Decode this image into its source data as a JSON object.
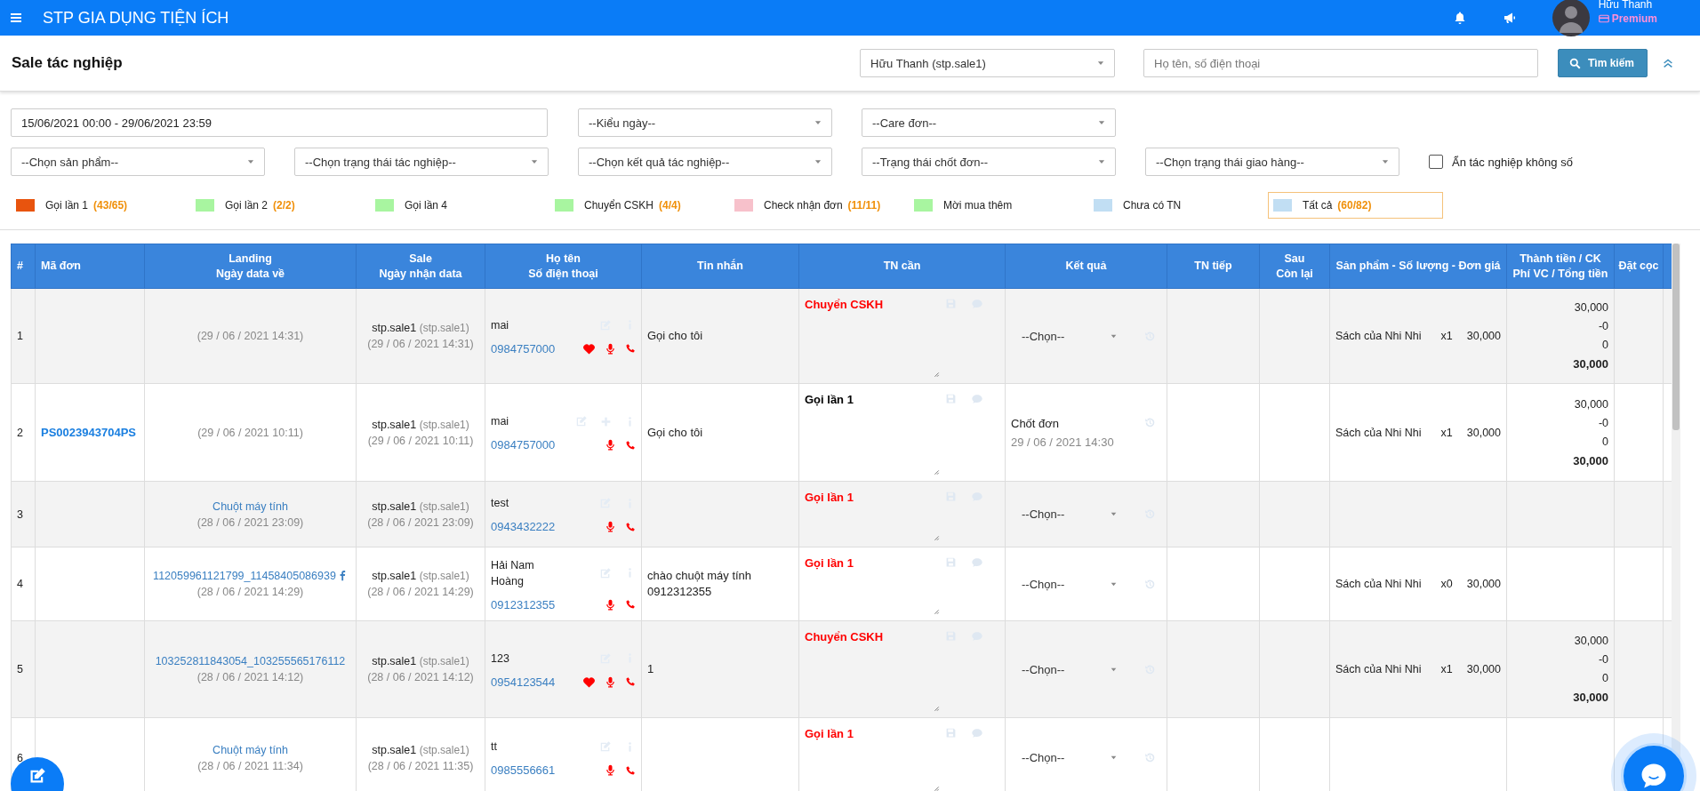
{
  "topbar": {
    "title": "STP GIA DỤNG TIỆN ÍCH",
    "user_name": "Hữu Thanh",
    "badge": "Premium"
  },
  "header": {
    "title": "Sale tác nghiệp",
    "user_select": "Hữu Thanh (stp.sale1)",
    "search": {
      "placeholder": "Họ tên, số điện thoại"
    },
    "search_button": "Tìm kiếm"
  },
  "filters": {
    "date_range": "15/06/2021 00:00 - 29/06/2021 23:59",
    "selects_row_1": [
      "--Kiểu ngày--",
      "--Care đơn--"
    ],
    "selects_row_2": [
      "--Chọn sản phẩm--",
      "--Chọn trạng thái tác nghiệp--",
      "--Chọn kết quả tác nghiệp--",
      "--Trạng thái chốt đơn--",
      "--Chọn trạng thái giao hàng--"
    ],
    "checkbox": {
      "label": "Ẩn tác nghiệp không số",
      "checked": false
    }
  },
  "legend": [
    {
      "label": "Gọi lần 1",
      "count": "(43/65)",
      "color": "#e8540e",
      "selected": false
    },
    {
      "label": "Gọi lần 2",
      "count": "(2/2)",
      "color": "#a8f5a0",
      "selected": false
    },
    {
      "label": "Gọi lần 4",
      "color": "#a8f5a0",
      "selected": false
    },
    {
      "label": "Chuyển CSKH",
      "count": "(4/4)",
      "color": "#a8f5a0",
      "selected": false
    },
    {
      "label": "Check nhận đơn",
      "count": "(11/11)",
      "color": "#f7c1cb",
      "selected": false
    },
    {
      "label": "Mời mua thêm",
      "color": "#a8f5a0",
      "selected": false
    },
    {
      "label": "Chưa có TN",
      "color": "#c1def3",
      "selected": false
    },
    {
      "label": "Tất cả",
      "count": "(60/82)",
      "color": "#c1def3",
      "selected": true
    }
  ],
  "table": {
    "columns": [
      "#",
      "Mã đơn",
      "Landing\nNgày data về",
      "Sale\nNgày nhận data",
      "Họ tên\nSố điện thoại",
      "Tin nhắn",
      "TN cần",
      "Kết quả",
      "TN tiếp",
      "Sau\nCòn lại",
      "Sản phẩm - Số lượng - Đơn giá",
      "Thành tiền / CK\nPhí VC / Tổng tiền",
      "Đặt cọc"
    ],
    "rows": [
      {
        "index": "1",
        "landing_date": "(29 / 06 / 2021 14:31)",
        "sale": "stp.sale1",
        "sale_account": "(stp.sale1)",
        "sale_date": "(29 / 06 / 2021 14:31)",
        "name": "mai",
        "phone": "0984757000",
        "favorite": true,
        "can_add": false,
        "message": "Gọi cho tôi",
        "need": "Chuyển CSKH",
        "need_urgent": true,
        "result": {
          "kind": "select",
          "value": "--Chọn--"
        },
        "product": "Sách của Nhi Nhi",
        "quantity": "x1",
        "price": "30,000",
        "totals": [
          "30,000",
          "-0",
          "0",
          "30,000"
        ]
      },
      {
        "index": "2",
        "order_code": "PS0023943704PS",
        "landing_date": "(29 / 06 / 2021 10:11)",
        "sale": "stp.sale1",
        "sale_account": "(stp.sale1)",
        "sale_date": "(29 / 06 / 2021 10:11)",
        "name": "mai",
        "phone": "0984757000",
        "favorite": false,
        "can_add": true,
        "message": "Gọi cho tôi",
        "need": "Gọi lần 1",
        "need_urgent": false,
        "result": {
          "kind": "text",
          "value": "Chốt đơn",
          "date": "29 / 06 / 2021 14:30"
        },
        "product": "Sách của Nhi Nhi",
        "quantity": "x1",
        "price": "30,000",
        "totals": [
          "30,000",
          "-0",
          "0",
          "30,000"
        ]
      },
      {
        "index": "3",
        "landing": "Chuột máy tính",
        "landing_date": "(28 / 06 / 2021 23:09)",
        "sale": "stp.sale1",
        "sale_account": "(stp.sale1)",
        "sale_date": "(28 / 06 / 2021 23:09)",
        "name": "test",
        "phone": "0943432222",
        "favorite": false,
        "can_add": false,
        "need": "Gọi lần 1",
        "need_urgent": true,
        "result": {
          "kind": "select",
          "value": "--Chọn--"
        }
      },
      {
        "index": "4",
        "landing": "112059961121799_11458405086939",
        "source_icon": true,
        "landing_date": "(28 / 06 / 2021 14:29)",
        "sale": "stp.sale1",
        "sale_account": "(stp.sale1)",
        "sale_date": "(28 / 06 / 2021 14:29)",
        "name": "Hải Nam\nHoàng",
        "phone": "0912312355",
        "favorite": false,
        "can_add": false,
        "message": "chào chuột máy tính\n0912312355",
        "need": "Gọi lần 1",
        "need_urgent": true,
        "result": {
          "kind": "select",
          "value": "--Chọn--"
        },
        "product": "Sách của Nhi Nhi",
        "quantity": "x0",
        "price": "30,000"
      },
      {
        "index": "5",
        "landing": "103252811843054_103255565176112",
        "landing_date": "(28 / 06 / 2021 14:12)",
        "sale": "stp.sale1",
        "sale_account": "(stp.sale1)",
        "sale_date": "(28 / 06 / 2021 14:12)",
        "name": "123",
        "phone": "0954123544",
        "favorite": true,
        "can_add": false,
        "message": "1",
        "need": "Chuyển CSKH",
        "need_urgent": true,
        "result": {
          "kind": "select",
          "value": "--Chọn--"
        },
        "product": "Sách của Nhi Nhi",
        "quantity": "x1",
        "price": "30,000",
        "totals": [
          "30,000",
          "-0",
          "0",
          "30,000"
        ]
      },
      {
        "index": "6",
        "landing": "Chuột máy tính",
        "landing_date": "(28 / 06 / 2021 11:34)",
        "sale": "stp.sale1",
        "sale_account": "(stp.sale1)",
        "sale_date": "(28 / 06 / 2021 11:35)",
        "name": "tt",
        "phone": "0985556661",
        "favorite": false,
        "can_add": false,
        "need": "Gọi lần 1",
        "need_urgent": true,
        "result": {
          "kind": "select",
          "value": "--Chọn--"
        }
      }
    ]
  }
}
